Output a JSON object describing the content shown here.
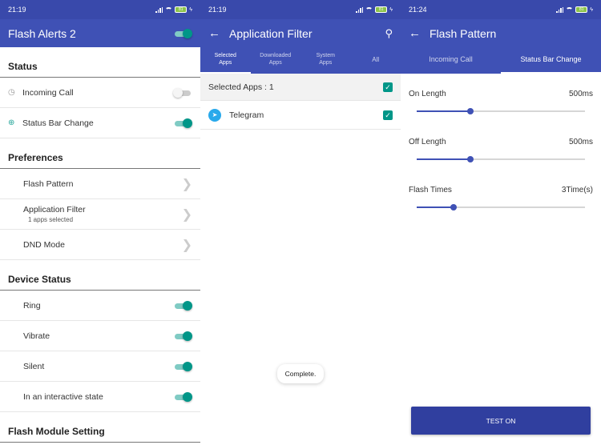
{
  "colors": {
    "primary": "#3f51b5",
    "statusbar": "#3949ab",
    "accent": "#009688",
    "button": "#303f9f"
  },
  "screen1": {
    "time": "21:19",
    "battery": "81",
    "title": "Flash Alerts 2",
    "sections": {
      "status": "Status",
      "preferences": "Preferences",
      "device_status": "Device Status",
      "flash_module": "Flash Module Setting"
    },
    "incoming_call": {
      "label": "Incoming Call",
      "icon": "clock-icon",
      "on": false
    },
    "status_bar_change": {
      "label": "Status Bar Change",
      "icon": "status-bar-icon",
      "on": true
    },
    "flash_pattern": "Flash Pattern",
    "application_filter": {
      "label": "Application Filter",
      "sub": "1 apps selected"
    },
    "dnd_mode": "DND Mode",
    "ring": "Ring",
    "vibrate": "Vibrate",
    "silent": "Silent",
    "interactive": "In an interactive state"
  },
  "screen2": {
    "time": "21:19",
    "battery": "81",
    "title": "Application Filter",
    "tabs": [
      {
        "line1": "Selected",
        "line2": "Apps"
      },
      {
        "line1": "Downloaded",
        "line2": "Apps"
      },
      {
        "line1": "System",
        "line2": "Apps"
      },
      {
        "line1": "All",
        "line2": ""
      }
    ],
    "selected_apps": "Selected Apps : 1",
    "app_name": "Telegram",
    "toast": "Complete."
  },
  "screen3": {
    "time": "21:24",
    "battery": "81",
    "title": "Flash Pattern",
    "tabs": [
      "Incoming Call",
      "Status Bar Change"
    ],
    "on_length": {
      "label": "On Length",
      "value": "500ms",
      "fraction": 0.32
    },
    "off_length": {
      "label": "Off Length",
      "value": "500ms",
      "fraction": 0.32
    },
    "flash_times": {
      "label": "Flash Times",
      "value": "3Time(s)",
      "fraction": 0.22
    },
    "test_button": "TEST ON"
  }
}
